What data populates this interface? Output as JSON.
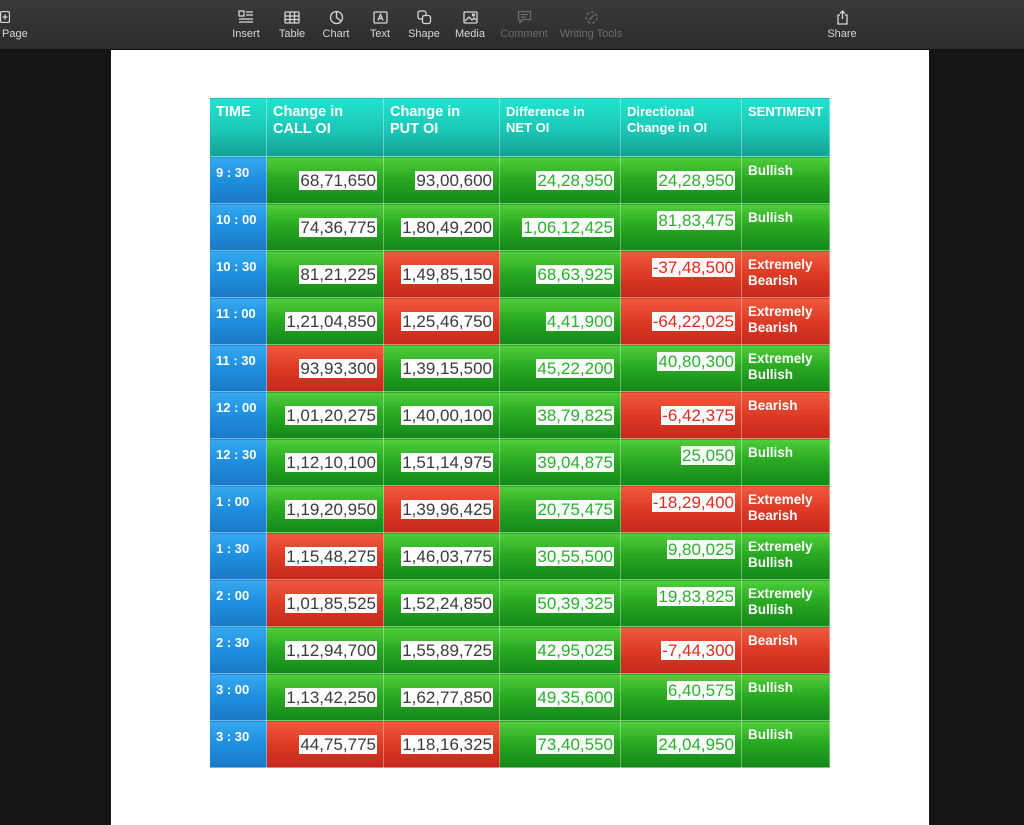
{
  "toolbar": {
    "page_label": "Page",
    "insert_label": "Insert",
    "table_label": "Table",
    "chart_label": "Chart",
    "text_label": "Text",
    "shape_label": "Shape",
    "media_label": "Media",
    "comment_label": "Comment",
    "writing_tools_label": "Writing Tools",
    "share_label": "Share"
  },
  "table": {
    "headers": {
      "time": "TIME",
      "call_oi": "Change in CALL OI",
      "put_oi": "Change in PUT OI",
      "net_oi": "Difference in NET OI",
      "directional": "Directional Change in OI",
      "sentiment": "SENTIMENT"
    },
    "colors": {
      "green": "#2aaa22",
      "red": "#dd3a25",
      "blue": "#1f8ede",
      "teal": "#1cc6b6"
    },
    "rows": [
      {
        "time": "9 : 30",
        "call": "68,71,650",
        "put": "93,00,600",
        "net": "24,28,950",
        "dir": "24,28,950",
        "sentiment": "Bullish"
      },
      {
        "time": "10 : 00",
        "call": "74,36,775",
        "put": "1,80,49,200",
        "net": "1,06,12,425",
        "dir": "81,83,475",
        "sentiment": "Bullish"
      },
      {
        "time": "10 : 30",
        "call": "81,21,225",
        "put": "1,49,85,150",
        "net": "68,63,925",
        "dir": "-37,48,500",
        "sentiment": "Extremely Bearish"
      },
      {
        "time": "11 : 00",
        "call": "1,21,04,850",
        "put": "1,25,46,750",
        "net": "4,41,900",
        "dir": "-64,22,025",
        "sentiment": "Extremely Bearish"
      },
      {
        "time": "11 : 30",
        "call": "93,93,300",
        "put": "1,39,15,500",
        "net": "45,22,200",
        "dir": "40,80,300",
        "sentiment": "Extremely Bullish"
      },
      {
        "time": "12 : 00",
        "call": "1,01,20,275",
        "put": "1,40,00,100",
        "net": "38,79,825",
        "dir": "-6,42,375",
        "sentiment": "Bearish"
      },
      {
        "time": "12 : 30",
        "call": "1,12,10,100",
        "put": "1,51,14,975",
        "net": "39,04,875",
        "dir": "25,050",
        "sentiment": "Bullish"
      },
      {
        "time": "1 : 00",
        "call": "1,19,20,950",
        "put": "1,39,96,425",
        "net": "20,75,475",
        "dir": "-18,29,400",
        "sentiment": "Extremely Bearish"
      },
      {
        "time": "1 : 30",
        "call": "1,15,48,275",
        "put": "1,46,03,775",
        "net": "30,55,500",
        "dir": "9,80,025",
        "sentiment": "Extremely Bullish"
      },
      {
        "time": "2 : 00",
        "call": "1,01,85,525",
        "put": "1,52,24,850",
        "net": "50,39,325",
        "dir": "19,83,825",
        "sentiment": "Extremely Bullish"
      },
      {
        "time": "2 : 30",
        "call": "1,12,94,700",
        "put": "1,55,89,725",
        "net": "42,95,025",
        "dir": "-7,44,300",
        "sentiment": "Bearish"
      },
      {
        "time": "3 : 00",
        "call": "1,13,42,250",
        "put": "1,62,77,850",
        "net": "49,35,600",
        "dir": "6,40,575",
        "sentiment": "Bullish"
      },
      {
        "time": "3 : 30",
        "call": "44,75,775",
        "put": "1,18,16,325",
        "net": "73,40,550",
        "dir": "24,04,950",
        "sentiment": "Bullish"
      }
    ]
  }
}
